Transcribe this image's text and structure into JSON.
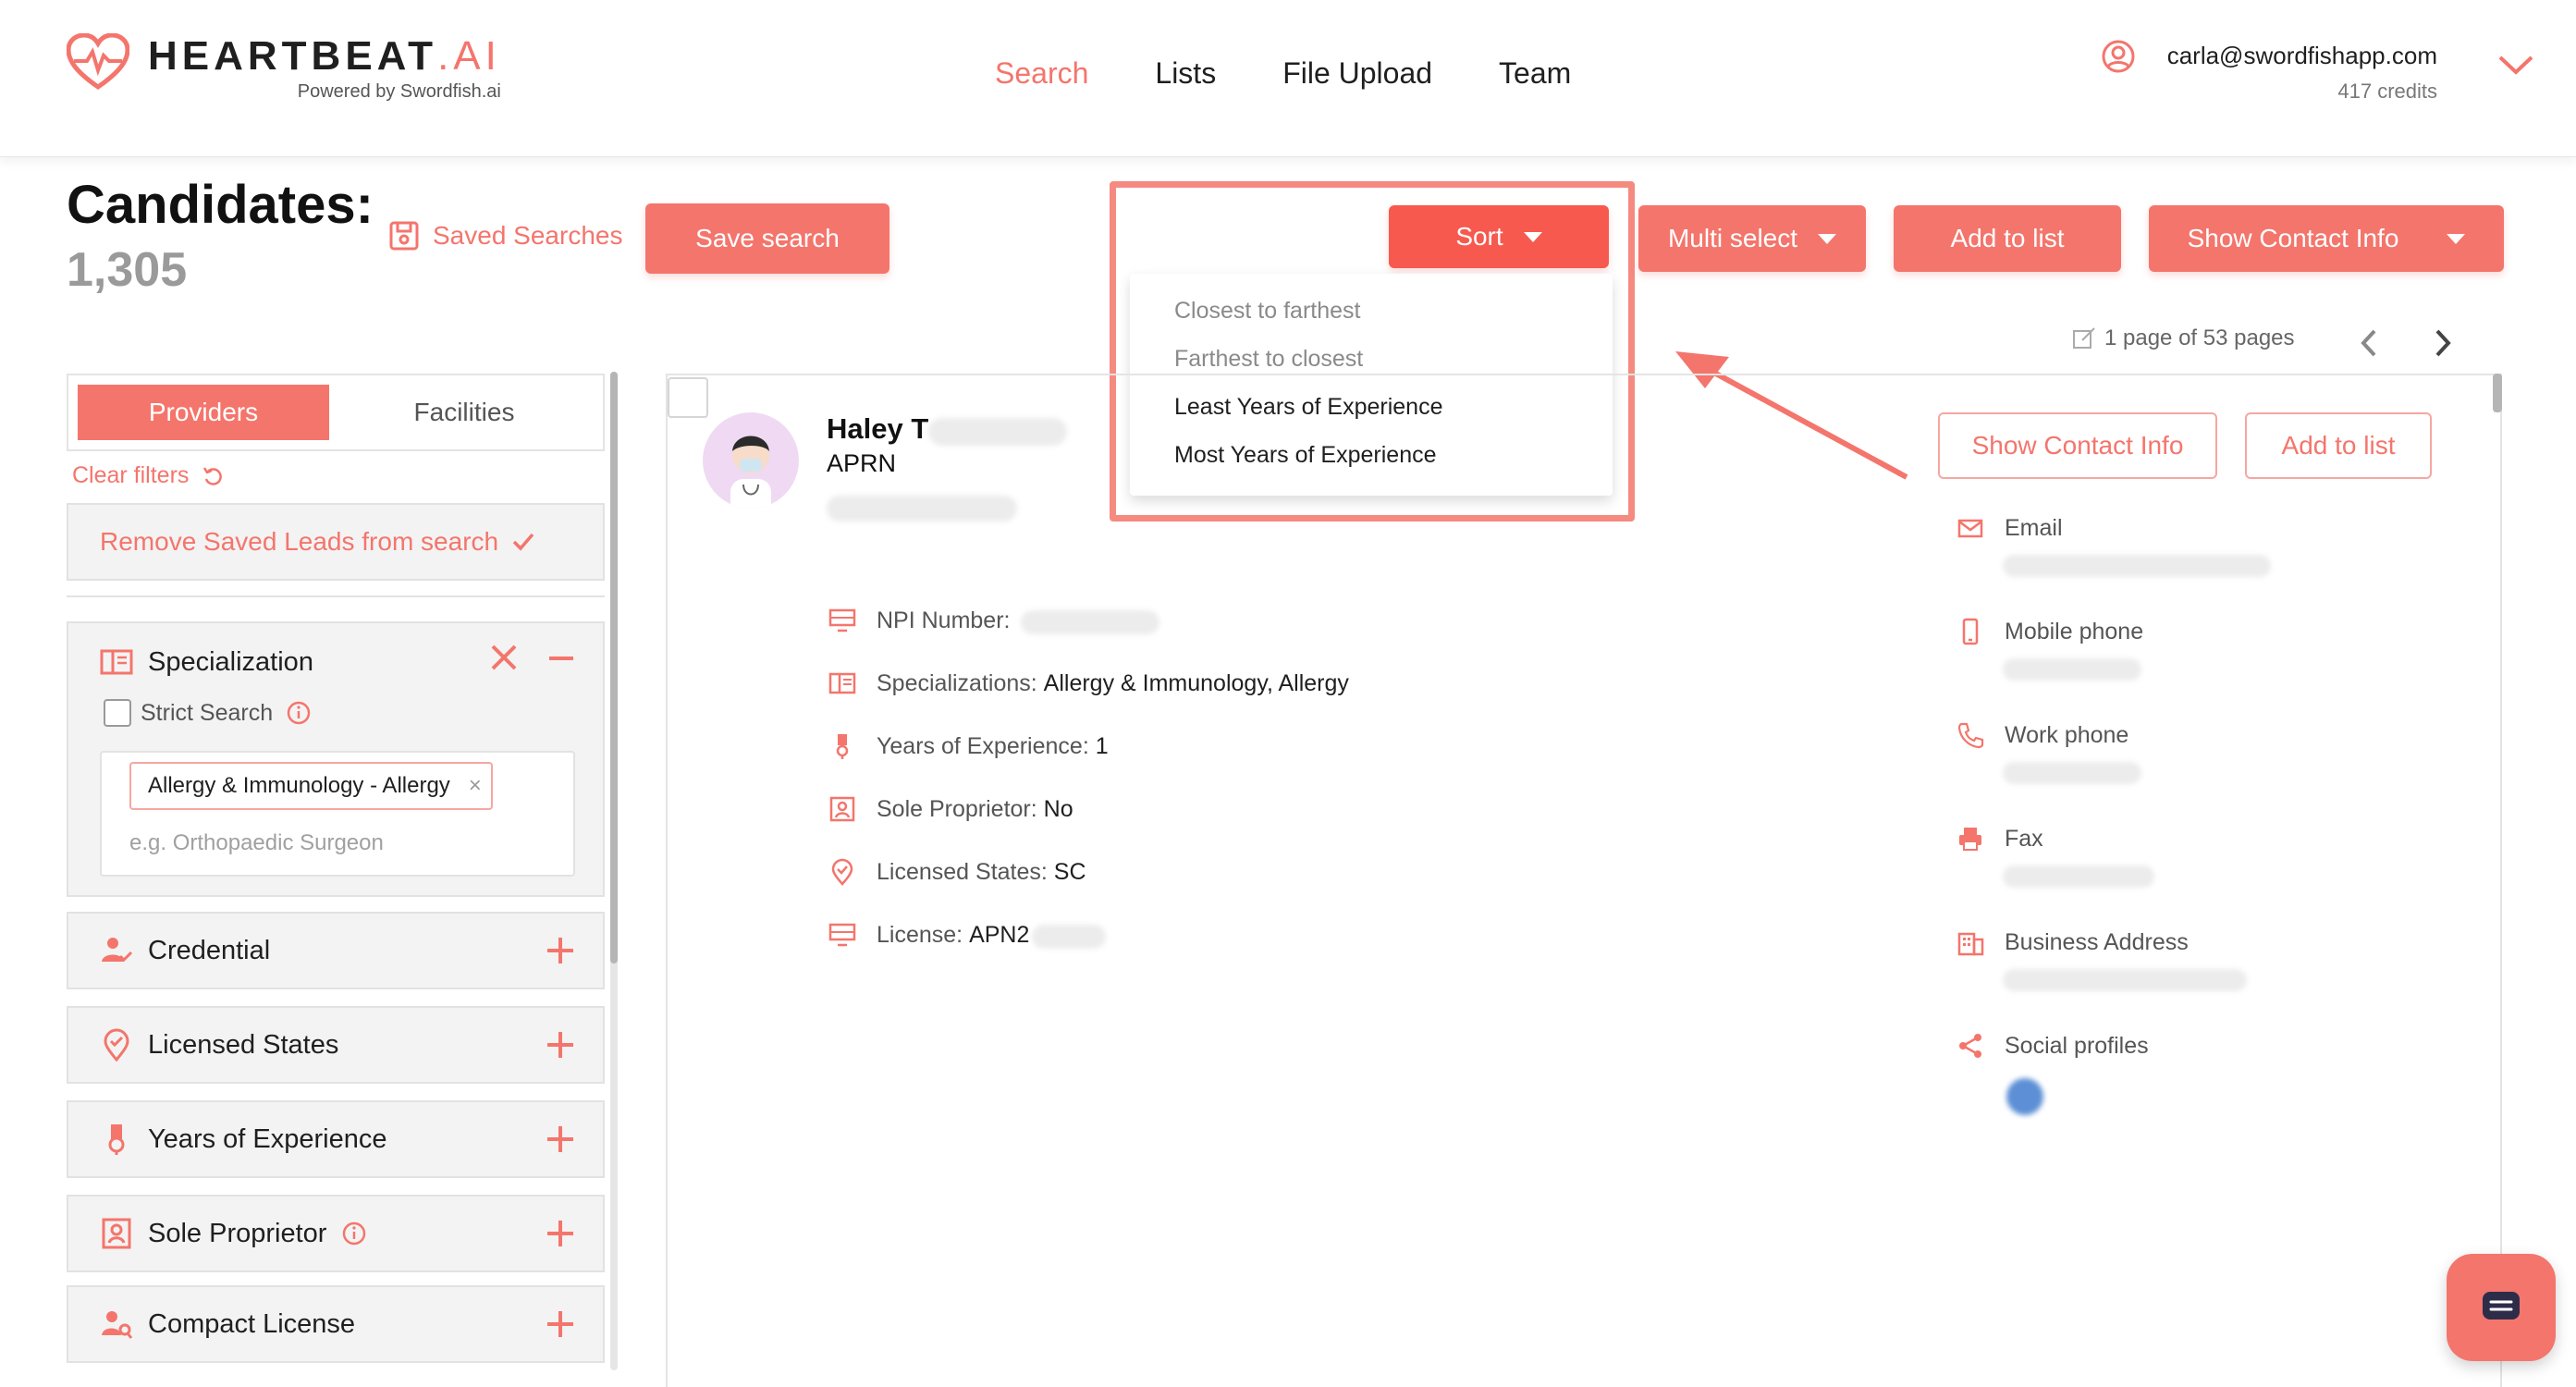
{
  "brand": {
    "name_main": "HEARTBEAT",
    "name_suffix": ".AI",
    "tagline": "Powered by Swordfish.ai",
    "accent": "#f4756c"
  },
  "nav": {
    "items": [
      {
        "label": "Search",
        "active": true
      },
      {
        "label": "Lists",
        "active": false
      },
      {
        "label": "File Upload",
        "active": false
      },
      {
        "label": "Team",
        "active": false
      }
    ]
  },
  "user": {
    "email": "carla@swordfishapp.com",
    "credits": "417 credits"
  },
  "toolbar": {
    "title": "Candidates:",
    "count": "1,305",
    "saved_searches": "Saved Searches",
    "save_search": "Save search",
    "sort": "Sort",
    "multi_select": "Multi select",
    "add_to_list": "Add  to list",
    "show_contact_info": "Show Contact Info"
  },
  "sort_menu": {
    "options": [
      "Closest to farthest",
      "Farthest to closest",
      "Least Years of Experience",
      "Most Years of Experience"
    ]
  },
  "pagination": {
    "label": "1 page of 53 pages"
  },
  "filters": {
    "tabs": [
      "Providers",
      "Facilities"
    ],
    "clear_filters": "Clear filters",
    "remove_saved": "Remove Saved Leads from search",
    "specialization": {
      "label": "Specialization",
      "strict_search": "Strict Search",
      "chip": "Allergy & Immunology - Allergy",
      "placeholder": "e.g. Orthopaedic Surgeon"
    },
    "panels": [
      "Credential",
      "Licensed States",
      "Years of Experience",
      "Sole Proprietor",
      "Compact License"
    ]
  },
  "candidate": {
    "name": "Haley T",
    "role": "APRN",
    "details": [
      {
        "label": "NPI Number:",
        "value": ""
      },
      {
        "label": "Specializations:",
        "value": "Allergy & Immunology, Allergy"
      },
      {
        "label": "Years of Experience:",
        "value": "1"
      },
      {
        "label": "Sole Proprietor:",
        "value": "No"
      },
      {
        "label": "Licensed States:",
        "value": "SC"
      },
      {
        "label": "License:",
        "value": "APN2"
      }
    ],
    "show_contact_info": "Show Contact Info",
    "add_to_list": "Add to list",
    "contacts": [
      "Email",
      "Mobile phone",
      "Work phone",
      "Fax",
      "Business Address",
      "Social profiles"
    ]
  }
}
